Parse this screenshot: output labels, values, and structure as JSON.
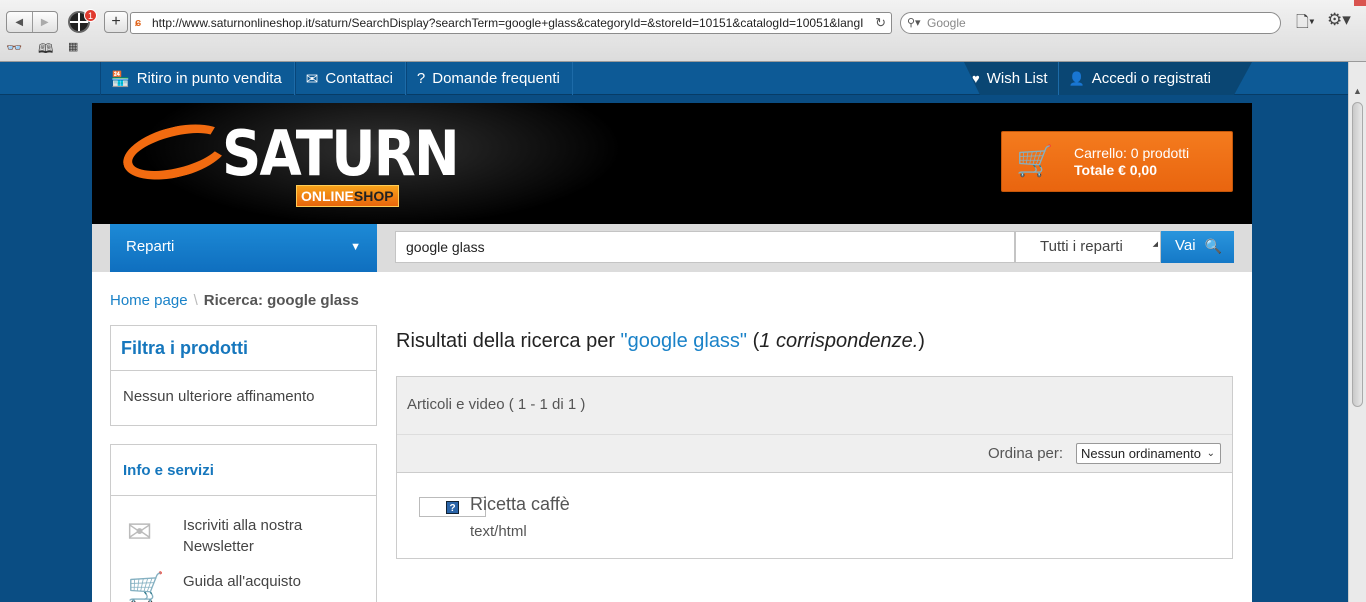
{
  "browser": {
    "url": "http://www.saturnonlineshop.it/saturn/SearchDisplay?searchTerm=google+glass&categoryId=&storeId=10151&catalogId=10051&langI",
    "search_placeholder": "Google",
    "extension_badge": "1"
  },
  "topbar": {
    "items": [
      {
        "label": "Ritiro in punto vendita",
        "icon": "store-icon"
      },
      {
        "label": "Contattaci",
        "icon": "envelope-icon"
      },
      {
        "label": "Domande frequenti",
        "icon": "question-icon"
      }
    ],
    "right": [
      {
        "label": "Wish List",
        "icon": "heart-icon"
      },
      {
        "label": "Accedi o registrati",
        "icon": "user-icon"
      }
    ]
  },
  "header": {
    "logo_word": "SATURN",
    "logo_sub_a": "ONLINE",
    "logo_sub_b": "SHOP",
    "cart_line1": "Carrello: 0 prodotti",
    "cart_line2": "Totale € 0,00"
  },
  "search": {
    "departments_label": "Reparti",
    "query": "google glass",
    "scope": "Tutti i reparti",
    "go": "Vai"
  },
  "breadcrumb": {
    "home": "Home page",
    "separator": "\\",
    "current": "Ricerca: google glass"
  },
  "sidebar": {
    "filter_title": "Filtra i prodotti",
    "filter_body": "Nessun ulteriore affinamento",
    "info_title": "Info e servizi",
    "info_items": [
      {
        "label": "Iscriviti alla nostra Newsletter",
        "icon": "newsletter-icon"
      },
      {
        "label": "Guida all'acquisto",
        "icon": "cart-icon"
      }
    ]
  },
  "results": {
    "title_prefix": "Risultati della ricerca per ",
    "query_quoted": "\"google glass\"",
    "open_paren": " (",
    "count_text": "1 corrispondenze.",
    "close_paren": ")",
    "section_label": "Articoli e video ( 1 - 1 di 1 )",
    "sort_label": "Ordina per:",
    "sort_selected": "Nessun ordinamento",
    "items": [
      {
        "title": "Ricetta caffè",
        "type": "text/html"
      }
    ]
  },
  "colors": {
    "brand_orange": "#f26b10",
    "brand_blue": "#0d5a96",
    "link_blue": "#1a82c8"
  }
}
